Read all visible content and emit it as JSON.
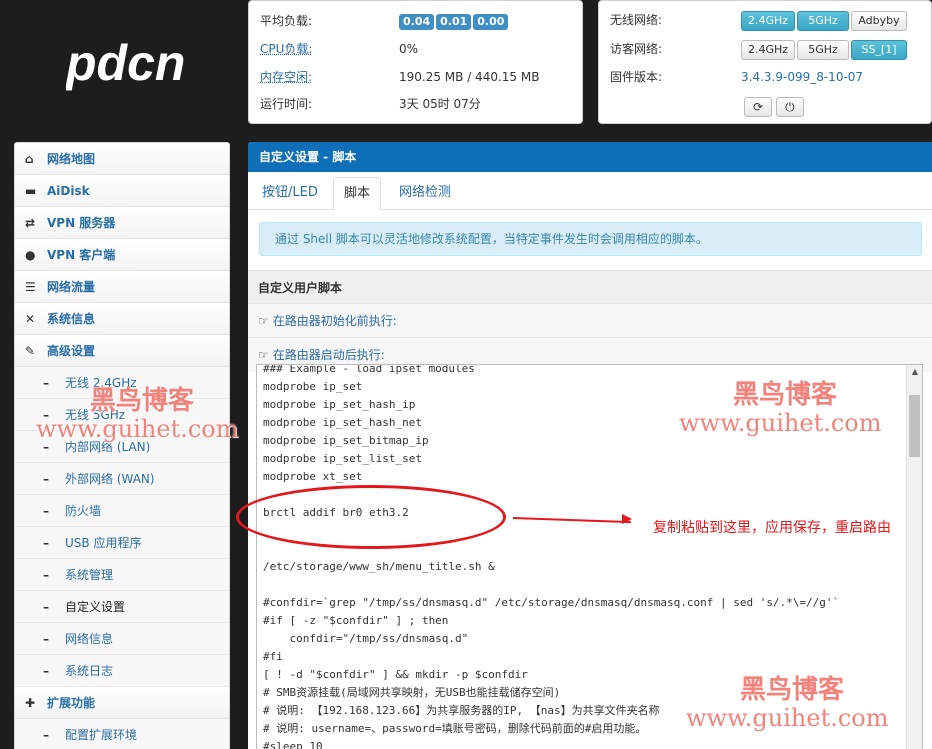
{
  "logo": {
    "text": "pdcn"
  },
  "system": {
    "load_label": "平均负载:",
    "load_values": [
      "0.04",
      "0.01",
      "0.00"
    ],
    "cpu_label": "CPU负载:",
    "cpu_value": "0%",
    "mem_label": "内存空闲:",
    "mem_value": "190.25 MB / 440.15 MB",
    "uptime_label": "运行时间:",
    "uptime_value": "3天 05时 07分"
  },
  "wireless": {
    "wifi_label": "无线网络:",
    "wifi_buttons": [
      {
        "label": "2.4GHz",
        "active": true
      },
      {
        "label": "5GHz",
        "active": true
      },
      {
        "label": "Adbyby",
        "active": false
      }
    ],
    "guest_label": "访客网络:",
    "guest_buttons": [
      {
        "label": "2.4GHz",
        "active": false
      },
      {
        "label": "5GHz",
        "active": false
      },
      {
        "label": "SS_[1]",
        "active": true
      }
    ],
    "firmware_label": "固件版本:",
    "firmware_value": "3.4.3.9-099_8-10-07",
    "refresh_icon": "refresh-icon",
    "power_icon": "power-icon"
  },
  "sidebar": {
    "main_items": [
      {
        "icon": "home-icon",
        "label": "网络地图"
      },
      {
        "icon": "disk-icon",
        "label": "AiDisk"
      },
      {
        "icon": "retweet-icon",
        "label": "VPN 服务器"
      },
      {
        "icon": "globe-icon",
        "label": "VPN 客户端"
      },
      {
        "icon": "list-icon",
        "label": "网络流量"
      },
      {
        "icon": "random-icon",
        "label": "系统信息"
      },
      {
        "icon": "wrench-icon",
        "label": "高级设置"
      }
    ],
    "sub_items": [
      {
        "label": "无线 2.4GHz"
      },
      {
        "label": "无线 5GHz"
      },
      {
        "label": "内部网络 (LAN)"
      },
      {
        "label": "外部网络 (WAN)"
      },
      {
        "label": "防火墙"
      },
      {
        "label": "USB 应用程序"
      },
      {
        "label": "系统管理"
      },
      {
        "label": "自定义设置",
        "active": true
      },
      {
        "label": "网络信息"
      },
      {
        "label": "系统日志"
      }
    ],
    "ext_item": {
      "icon": "plus-icon",
      "label": "扩展功能"
    },
    "ext_sub": {
      "label": "配置扩展环境"
    }
  },
  "main": {
    "title": "自定义设置 - 脚本",
    "tabs": [
      {
        "label": "按钮/LED"
      },
      {
        "label": "脚本",
        "active": true
      },
      {
        "label": "网络检测"
      }
    ],
    "info": "通过 Shell 脚本可以灵活地修改系统配置，当特定事件发生时会调用相应的脚本。",
    "section_title": "自定义用户脚本",
    "exec_before": "在路由器初始化前执行:",
    "exec_after": "在路由器启动后执行:",
    "script_lines": [
      "### Example - load ipset modules",
      "modprobe ip_set",
      "modprobe ip_set_hash_ip",
      "modprobe ip_set_hash_net",
      "modprobe ip_set_bitmap_ip",
      "modprobe ip_set_list_set",
      "modprobe xt_set",
      "",
      "brctl addif br0 eth3.2",
      "",
      "",
      "/etc/storage/www_sh/menu_title.sh &",
      "",
      "#confdir=`grep \"/tmp/ss/dnsmasq.d\" /etc/storage/dnsmasq/dnsmasq.conf | sed 's/.*\\=//g'`",
      "#if [ -z \"$confdir\" ] ; then",
      "    confdir=\"/tmp/ss/dnsmasq.d\"",
      "#fi",
      "[ ! -d \"$confdir\" ] && mkdir -p $confdir",
      "# SMB资源挂载(局域网共享映射，无USB也能挂载储存空间)",
      "# 说明: 【192.168.123.66】为共享服务器的IP, 【nas】为共享文件夹名称",
      "# 说明: username=、password=填账号密码，删除代码前面的#启用功能。",
      "#sleep 10"
    ]
  },
  "annotation": {
    "text": "复制粘贴到这里，应用保存，重启路由"
  },
  "watermarks": {
    "cn": "黑鸟博客",
    "en": "www.guihet.com"
  }
}
